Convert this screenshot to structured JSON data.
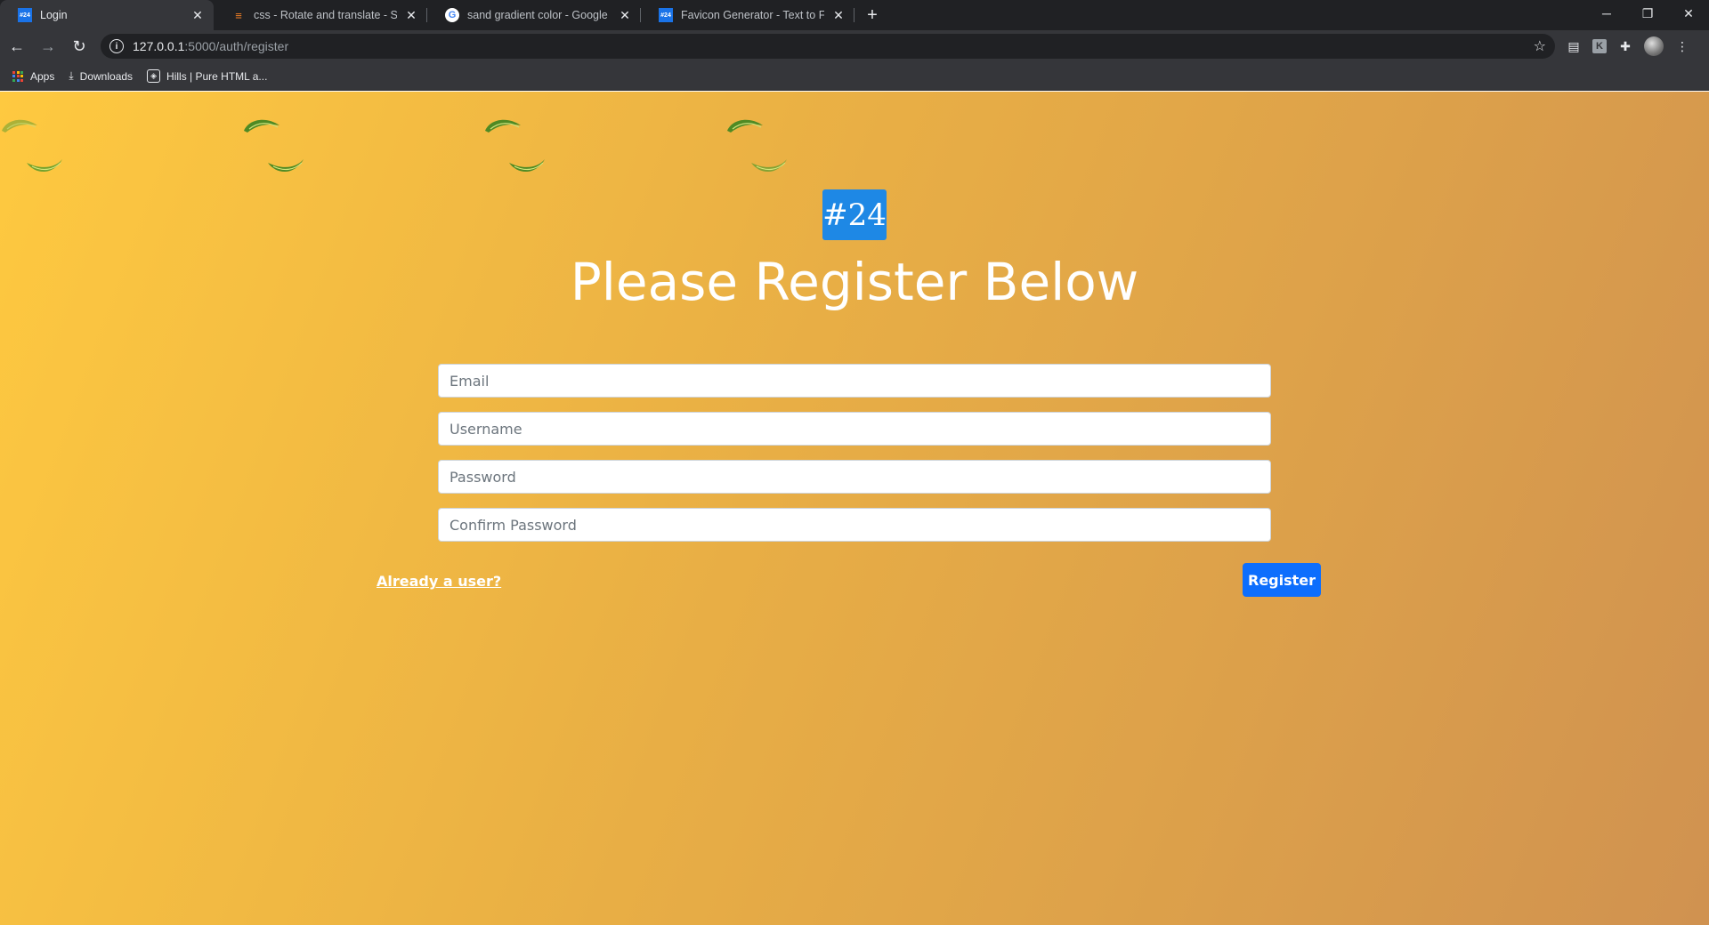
{
  "browser": {
    "tabs": [
      {
        "title": "Login",
        "favicon": "#24",
        "active": true
      },
      {
        "title": "css - Rotate and translate - Stack",
        "favicon": "stackoverflow-icon",
        "active": false
      },
      {
        "title": "sand gradient color - Google Sea",
        "favicon": "google-icon",
        "active": false
      },
      {
        "title": "Favicon Generator - Text to Favic",
        "favicon": "#24",
        "active": false
      }
    ],
    "new_tab_symbol": "+",
    "address": {
      "host": "127.0.0.1",
      "path": ":5000/auth/register"
    },
    "bookmarks": [
      {
        "label": "Apps"
      },
      {
        "label": "Downloads"
      },
      {
        "label": "Hills | Pure HTML a..."
      }
    ]
  },
  "page": {
    "logo_text": "#24",
    "heading": "Please Register Below",
    "fields": {
      "email": {
        "placeholder": "Email",
        "value": ""
      },
      "username": {
        "placeholder": "Username",
        "value": ""
      },
      "password": {
        "placeholder": "Password",
        "value": ""
      },
      "confirm_password": {
        "placeholder": "Confirm Password",
        "value": ""
      }
    },
    "already_user_link": "Already a user?",
    "register_button": "Register"
  },
  "colors": {
    "gradient_start": "#fec940",
    "gradient_end": "#d09250",
    "primary_button": "#0d6efd",
    "logo_bg": "#1e88e5"
  }
}
